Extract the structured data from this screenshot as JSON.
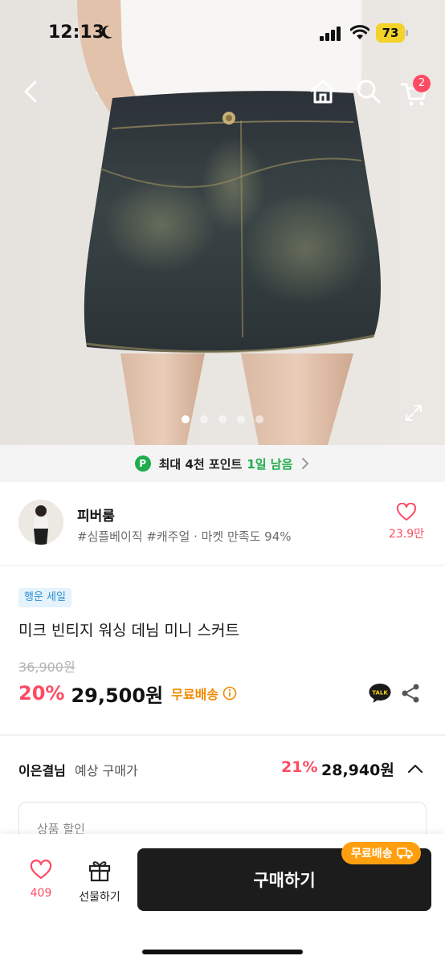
{
  "status_bar": {
    "time": "12:13",
    "battery": "73"
  },
  "header": {
    "cart_count": "2"
  },
  "gallery": {
    "image_count": 5,
    "active_index": 0
  },
  "points_banner": {
    "badge": "P",
    "text": "최대 4천 포인트",
    "highlight": "1일 남음"
  },
  "shop": {
    "name": "피버룸",
    "tags": "#심플베이직 #캐주얼 · 마켓 만족도 94%",
    "likes": "23.9만"
  },
  "product": {
    "sale_badge": "행운 세일",
    "title": "미크 빈티지 워싱 데님 미니 스커트",
    "original_price": "36,900원",
    "discount": "20%",
    "price": "29,500원",
    "shipping": "무료배송"
  },
  "expected_price": {
    "user_name": "이은결님",
    "label": "예상 구매가",
    "discount": "21%",
    "price": "28,940원"
  },
  "discount_card": {
    "label": "상품 할인"
  },
  "bottom_bar": {
    "wish_count": "409",
    "gift_label": "선물하기",
    "buy_label": "구매하기",
    "buy_tag": "무료배송"
  },
  "colors": {
    "accent_pink": "#ff4a64",
    "green": "#1eac4c",
    "orange": "#f08a00",
    "tag_orange": "#ff9f0f",
    "dark_button": "#1c1c1c",
    "sale_badge_blue": "#2f8fd0"
  },
  "icons": [
    "back-icon",
    "home-icon",
    "search-icon",
    "cart-icon",
    "expand-icon",
    "chevron-right-icon",
    "heart-icon",
    "info-icon",
    "kakao-talk-icon",
    "share-icon",
    "chevron-up-icon",
    "gift-icon",
    "truck-icon",
    "moon-icon",
    "signal-icon",
    "wifi-icon"
  ]
}
